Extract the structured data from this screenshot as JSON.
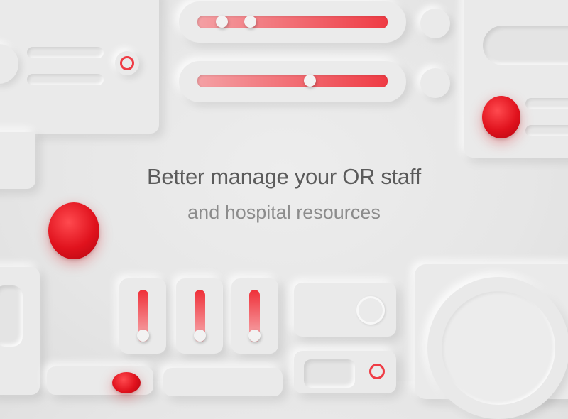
{
  "hero": {
    "line1": "Better manage your OR staff",
    "line2": "and hospital resources"
  },
  "sliders": {
    "top_range": {
      "low": 0.12,
      "high": 0.27
    },
    "middle": {
      "value": 0.59
    }
  },
  "vertical_sliders": [
    {
      "value": 0.0
    },
    {
      "value": 0.0
    },
    {
      "value": 0.0
    }
  ],
  "colors": {
    "accent": "#ef3b44",
    "accent_dark": "#d1101b",
    "background": "#e8e8e8",
    "text_primary": "#5b5b5b",
    "text_secondary": "#8c8c8c"
  },
  "icons": [
    "radio-ring-icon",
    "red-status-dot-icon",
    "toggle-ring-icon"
  ]
}
